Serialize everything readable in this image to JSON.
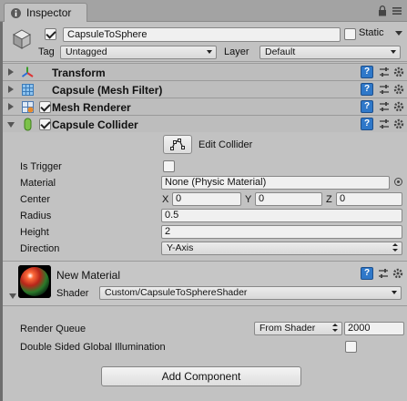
{
  "window": {
    "tab_title": "Inspector",
    "tab_icon": "info-icon",
    "lock_icon": "lock-icon",
    "menu_icon": "kebab-menu-icon"
  },
  "object": {
    "active": true,
    "name": "CapsuleToSphere",
    "static_label": "Static",
    "static_checked": false,
    "tag_label": "Tag",
    "tag_value": "Untagged",
    "layer_label": "Layer",
    "layer_value": "Default",
    "icon": "cube-icon"
  },
  "components": [
    {
      "title": "Transform",
      "expanded": false,
      "has_checkbox": false,
      "icon": "transform-axes-icon"
    },
    {
      "title": "Capsule (Mesh Filter)",
      "expanded": false,
      "has_checkbox": false,
      "icon": "mesh-filter-grid-icon"
    },
    {
      "title": "Mesh Renderer",
      "expanded": false,
      "has_checkbox": true,
      "checked": true,
      "icon": "mesh-renderer-icon"
    },
    {
      "title": "Capsule Collider",
      "expanded": true,
      "has_checkbox": true,
      "checked": true,
      "icon": "capsule-collider-icon"
    }
  ],
  "collider": {
    "edit_label": "Edit Collider",
    "is_trigger_label": "Is Trigger",
    "is_trigger": false,
    "material_label": "Material",
    "material_value": "None (Physic Material)",
    "center_label": "Center",
    "center": {
      "x_label": "X",
      "x": "0",
      "y_label": "Y",
      "y": "0",
      "z_label": "Z",
      "z": "0"
    },
    "radius_label": "Radius",
    "radius": "0.5",
    "height_label": "Height",
    "height": "2",
    "direction_label": "Direction",
    "direction": "Y-Axis"
  },
  "material": {
    "name": "New Material",
    "shader_label": "Shader",
    "shader_value": "Custom/CapsuleToSphereShader",
    "render_queue_label": "Render Queue",
    "render_queue_mode": "From Shader",
    "render_queue_value": "2000",
    "double_sided_label": "Double Sided Global Illumination",
    "double_sided": false
  },
  "add_component_label": "Add Component",
  "colors": {
    "panel_bg": "#c2c2c2",
    "help_icon_blue": "#2f78c9"
  }
}
